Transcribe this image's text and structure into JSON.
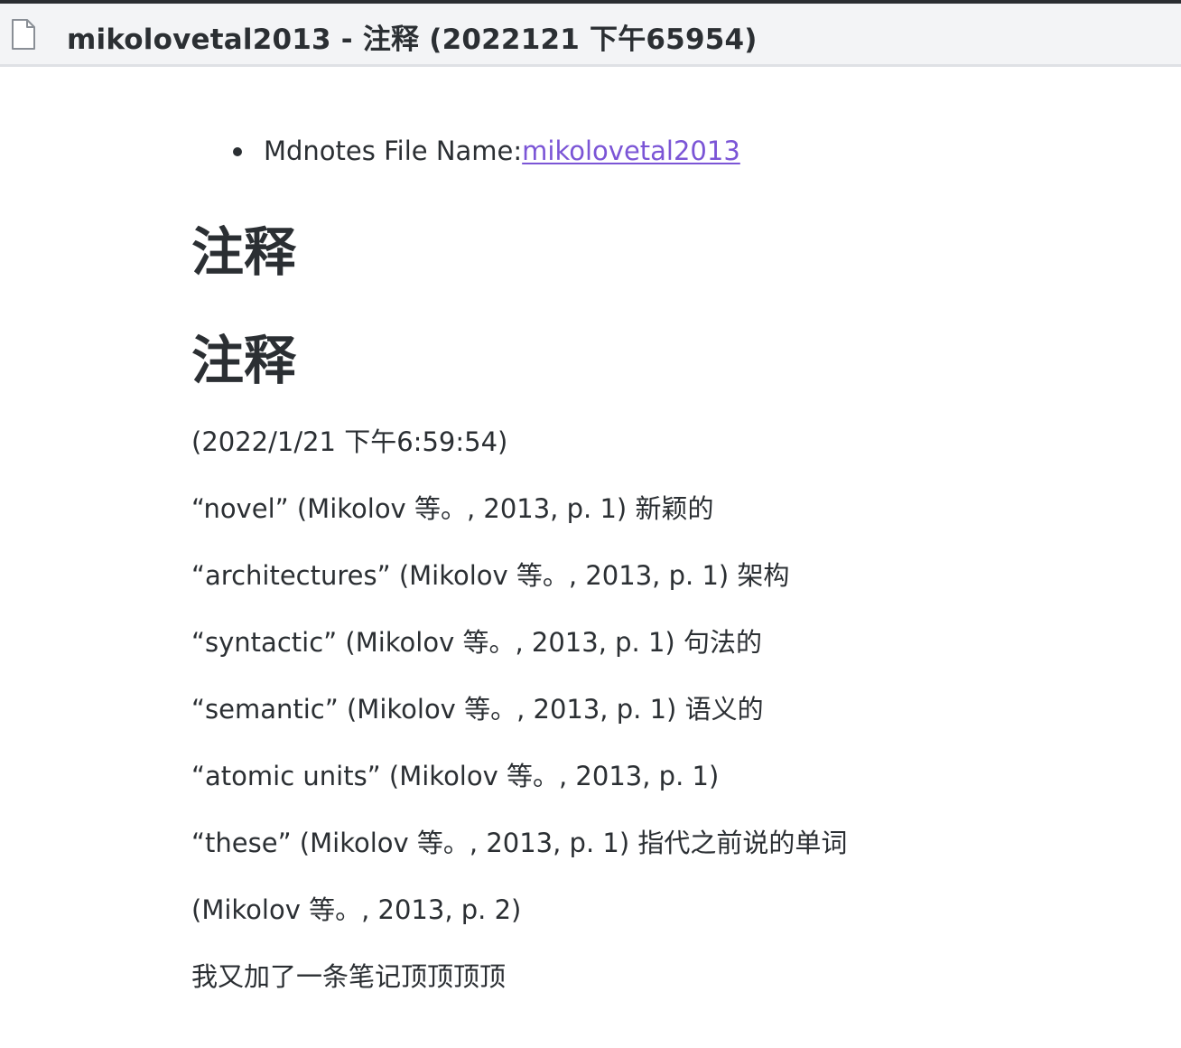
{
  "window": {
    "title": "mikolovetal2013 - 注释 (2022121 下午65954)",
    "icon": "file-icon"
  },
  "doc": {
    "meta_label": "Mdnotes File Name: ",
    "meta_link": "mikolovetal2013",
    "heading_1": "注释",
    "heading_2": "注释",
    "paragraphs": [
      "(2022/1/21 下午6:59:54)",
      "“novel” (Mikolov 等。, 2013, p. 1) 新颖的",
      "“architectures” (Mikolov 等。, 2013, p. 1) 架构",
      "“syntactic” (Mikolov 等。, 2013, p. 1) 句法的",
      "“semantic” (Mikolov 等。, 2013, p. 1) 语义的",
      "“atomic units” (Mikolov 等。, 2013, p. 1)",
      "“these” (Mikolov 等。, 2013, p. 1) 指代之前说的单词",
      "(Mikolov 等。, 2013, p. 2)",
      "我又加了一条笔记顶顶顶顶"
    ]
  },
  "colors": {
    "link": "#7b55d6",
    "text": "#2b2f33",
    "titlebar_bg": "#f3f4f6"
  }
}
